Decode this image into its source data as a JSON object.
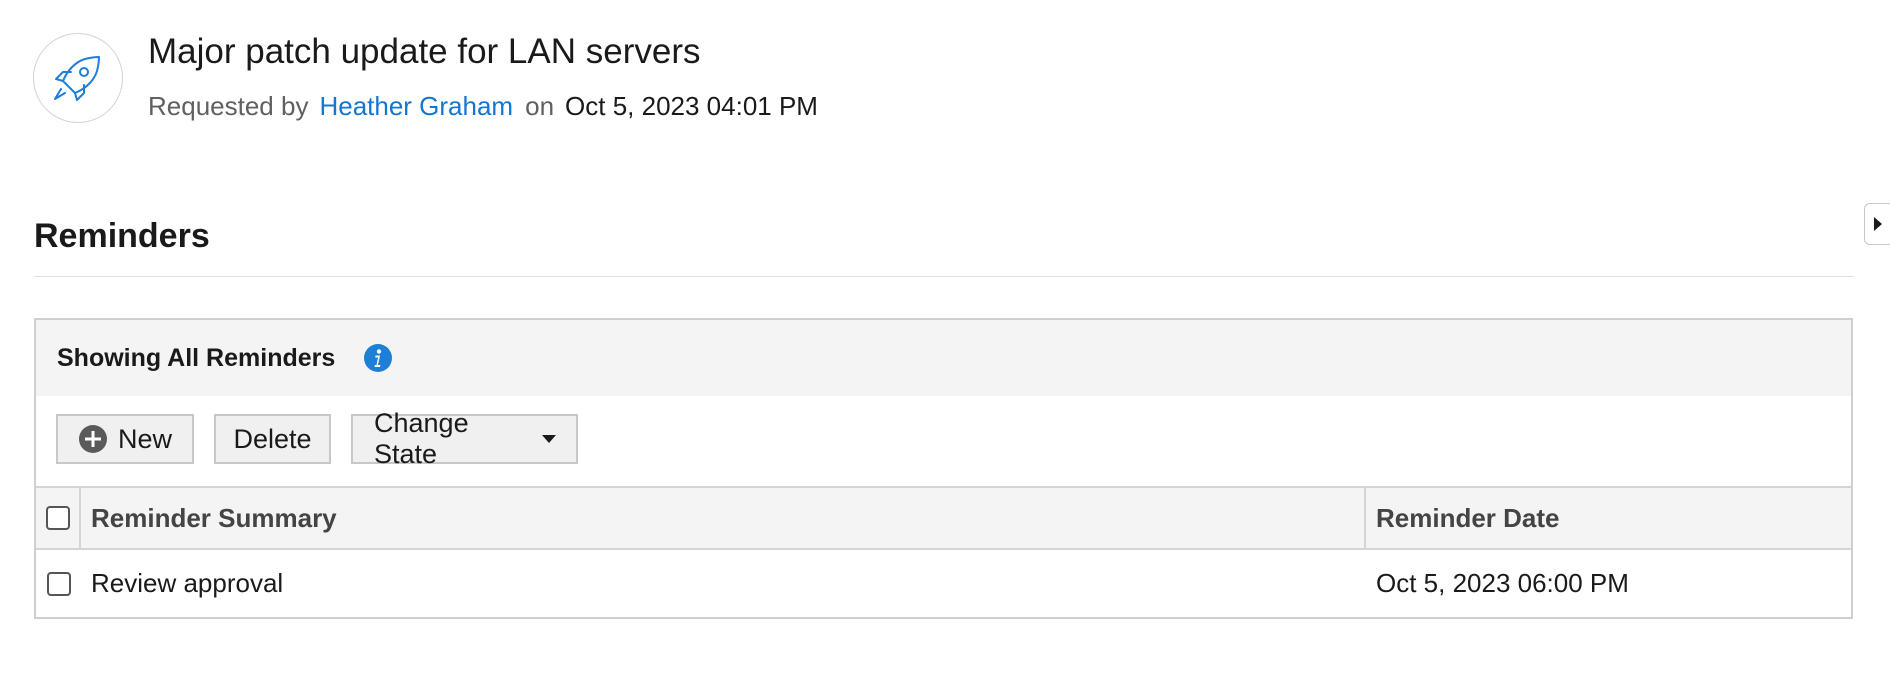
{
  "request": {
    "title": "Major patch update for LAN servers",
    "requested_by_label": "Requested by",
    "requester": "Heather Graham",
    "on_label": "on",
    "created_date": "Oct 5, 2023 04:01 PM",
    "icon": "rocket-icon"
  },
  "section": {
    "title": "Reminders"
  },
  "panel": {
    "heading": "Showing All Reminders",
    "info_icon": "info-icon",
    "toolbar": {
      "new_label": "New",
      "delete_label": "Delete",
      "change_state_label": "Change State"
    },
    "table": {
      "columns": [
        "Reminder Summary",
        "Reminder Date"
      ],
      "rows": [
        {
          "summary": "Review approval",
          "date": "Oct 5, 2023 06:00 PM"
        }
      ]
    }
  },
  "colors": {
    "link": "#1576d0",
    "icon_blue": "#1e7fd6",
    "panel_header_bg": "#f4f4f4",
    "border": "#cfcfcf"
  }
}
